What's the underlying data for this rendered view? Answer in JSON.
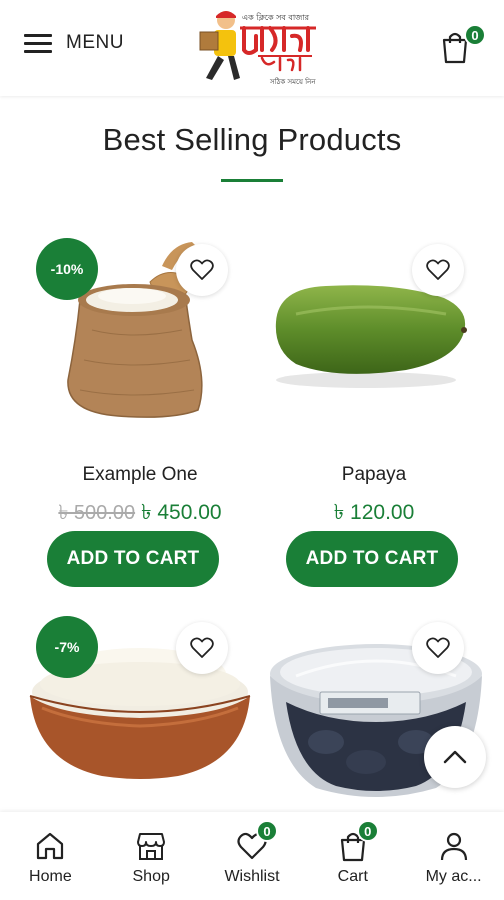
{
  "header": {
    "menu_label": "MENU",
    "cart_count": "0"
  },
  "section": {
    "title": "Best Selling Products"
  },
  "products": [
    {
      "name": "Example One",
      "old_price": "৳ 500.00",
      "price": "৳ 450.00",
      "discount": "-10%",
      "button": "ADD TO CART",
      "image": "rice-sack"
    },
    {
      "name": "Papaya",
      "old_price": "",
      "price": "৳ 120.00",
      "discount": "",
      "button": "ADD TO CART",
      "image": "papaya"
    },
    {
      "name": "",
      "old_price": "",
      "price": "",
      "discount": "-7%",
      "button": "",
      "image": "rice-bowl"
    },
    {
      "name": "",
      "old_price": "",
      "price": "",
      "discount": "",
      "button": "",
      "image": "dates-container"
    }
  ],
  "bottom_nav": {
    "items": [
      {
        "label": "Home",
        "icon": "home-icon"
      },
      {
        "label": "Shop",
        "icon": "shop-icon"
      },
      {
        "label": "Wishlist",
        "icon": "heart-icon",
        "badge": "0"
      },
      {
        "label": "Cart",
        "icon": "bag-icon",
        "badge": "0"
      },
      {
        "label": "My ac...",
        "icon": "user-icon"
      }
    ]
  },
  "colors": {
    "accent": "#1a7f37",
    "muted_price": "#aaaaaa"
  }
}
